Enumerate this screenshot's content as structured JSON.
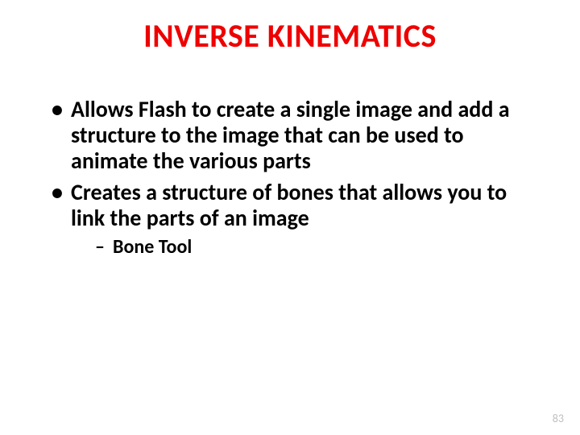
{
  "title": "INVERSE KINEMATICS",
  "bullets": [
    {
      "text": "Allows Flash to create a single image and add a structure to the image that can be used to animate the various parts"
    },
    {
      "text": "Creates a structure of bones that allows you to link the parts of an image",
      "sub": [
        {
          "text": "Bone Tool"
        }
      ]
    }
  ],
  "page_number": "83",
  "colors": {
    "title": "#ee0000",
    "text": "#000000",
    "pagenum": "#bfbfbf"
  }
}
